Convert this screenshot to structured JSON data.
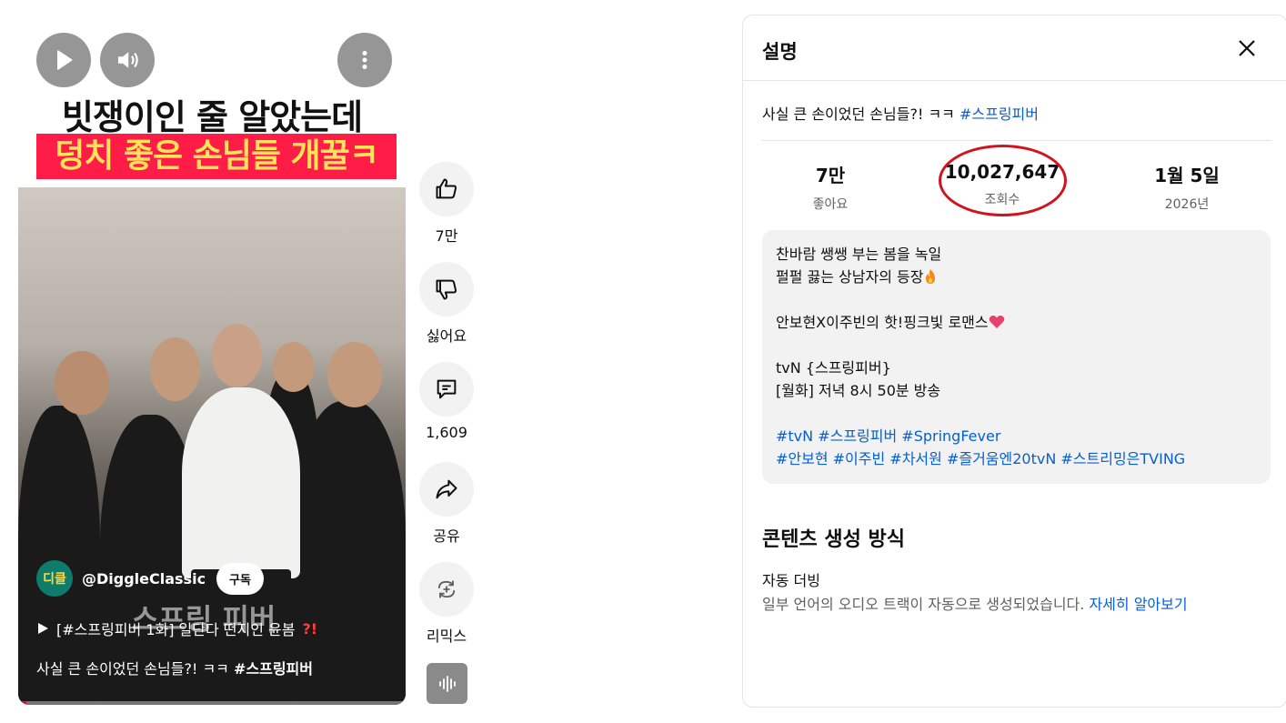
{
  "player": {
    "thumbnail_headline_1": "빗쟁이인 줄 알았는데",
    "thumbnail_headline_2": "덩치 좋은 손님들 개꿀ㅋ",
    "channel_handle": "@DiggleClassic",
    "channel_avatar_text": "디클",
    "subscribe_label": "구독",
    "watermark": "스프링 피버",
    "playlist_text": "[#스프링피버 1화] 일단다 떤지인 윤봄",
    "playlist_marks": "?!",
    "caption_text": "사실 큰 손이었던 손님들?! ㅋㅋ ",
    "caption_tag": "#스프링피버",
    "progress": 0.02
  },
  "actions": {
    "like_count": "7만",
    "dislike_label": "싫어요",
    "comment_count": "1,609",
    "share_label": "공유",
    "remix_label": "리믹스"
  },
  "description": {
    "title": "설명",
    "summary": "사실 큰 손이었던 손님들?! ㅋㅋ ",
    "summary_tag": "#스프링피버",
    "stats": [
      {
        "value": "7만",
        "label": "좋아요"
      },
      {
        "value": "10,027,647",
        "label": "조회수"
      },
      {
        "value": "1월 5일",
        "label": "2026년"
      }
    ],
    "body": {
      "line1": "찬바람 쌩쌩 부는 봄을 녹일",
      "line2": "펄펄 끓는 상남자의 등장",
      "line3": "안보현X이주빈의 핫!핑크빛 로맨스",
      "line4": "tvN {스프링피버}",
      "line5": "[월화] 저녁 8시 50분 방송",
      "tags1": "#tvN #스프링피버 #SpringFever",
      "tags2": "#안보현 #이주빈 #차서원 #즐거움엔20tvN #스트리밍은TVING"
    },
    "content_section_title": "콘텐츠 생성 방식",
    "auto_dub_title": "자동 더빙",
    "auto_dub_text": "일부 언어의 오디오 트랙이 자동으로 생성되었습니다. ",
    "learn_more": "자세히 알아보기"
  },
  "colors": {
    "link": "#065fd4",
    "highlight_circle": "#d0141f",
    "progress": "#ff0033"
  }
}
